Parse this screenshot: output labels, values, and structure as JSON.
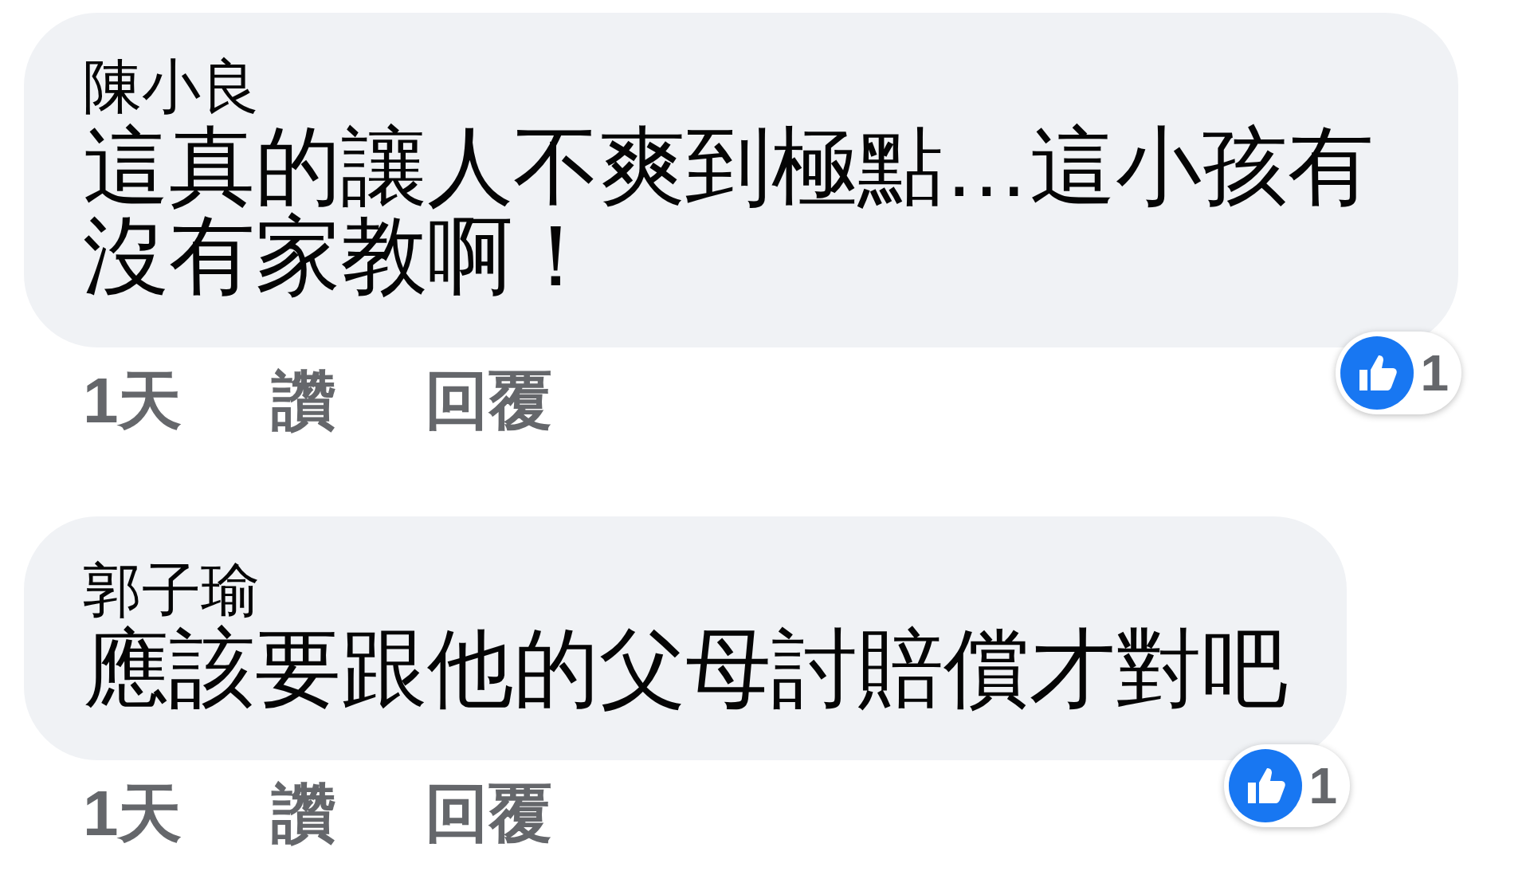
{
  "comments": [
    {
      "author": "陳小良",
      "text": "這真的讓人不爽到極點…這小孩有沒有家教啊！",
      "time": "1天",
      "actions": [
        "讚",
        "回覆"
      ],
      "reaction_count": "1"
    },
    {
      "author": "郭子瑜",
      "text": "應該要跟他的父母討賠償才對吧",
      "time": "1天",
      "actions": [
        "讚",
        "回覆"
      ],
      "reaction_count": "1"
    }
  ]
}
